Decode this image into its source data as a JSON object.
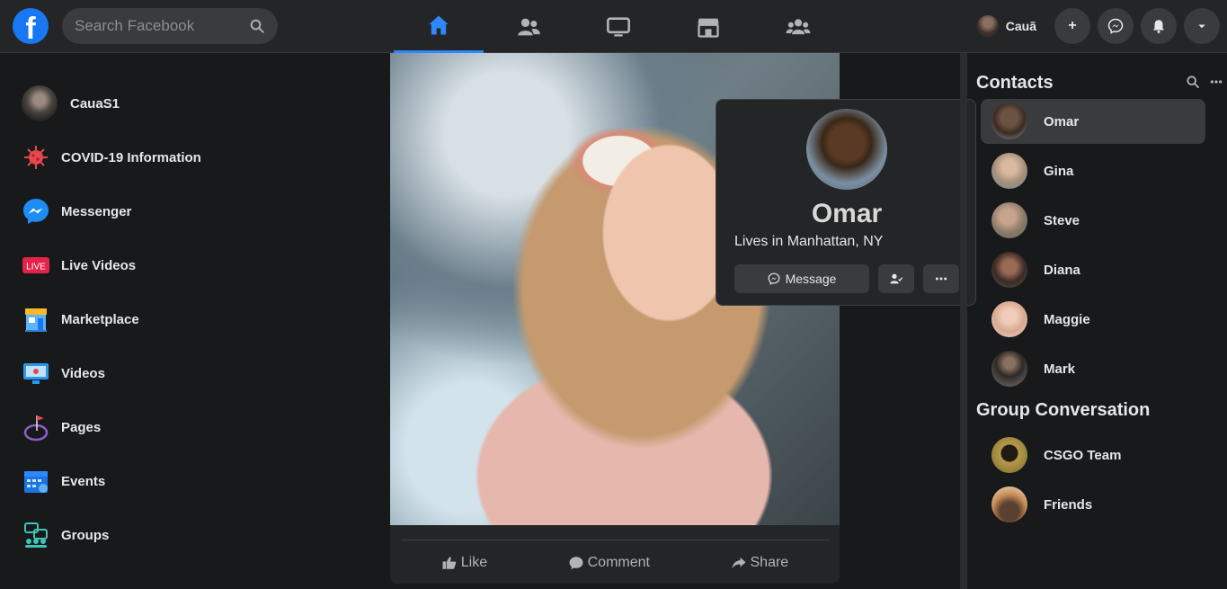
{
  "topbar": {
    "logo_letter": "f",
    "search_placeholder": "Search Facebook",
    "tabs": [
      {
        "name": "home",
        "active": true
      },
      {
        "name": "friends",
        "active": false
      },
      {
        "name": "watch",
        "active": false
      },
      {
        "name": "marketplace",
        "active": false
      },
      {
        "name": "groups",
        "active": false
      }
    ],
    "profile_name": "Cauã",
    "create_label": "+",
    "accent_color": "#2d88ff"
  },
  "left_nav": {
    "user_name": "CauaS1",
    "items": [
      {
        "label": "COVID-19 Information",
        "icon": "virus-icon"
      },
      {
        "label": "Messenger",
        "icon": "messenger-icon"
      },
      {
        "label": "Live Videos",
        "icon": "live-icon",
        "badge": "LIVE"
      },
      {
        "label": "Marketplace",
        "icon": "marketplace-icon"
      },
      {
        "label": "Videos",
        "icon": "videos-icon"
      },
      {
        "label": "Pages",
        "icon": "pages-icon"
      },
      {
        "label": "Events",
        "icon": "events-icon"
      },
      {
        "label": "Groups",
        "icon": "groups-icon"
      }
    ]
  },
  "post": {
    "actions": {
      "like": "Like",
      "comment": "Comment",
      "share": "Share"
    }
  },
  "hover_card": {
    "name": "Omar",
    "location": "Lives in Manhattan, NY",
    "message_label": "Message"
  },
  "contacts": {
    "title": "Contacts",
    "items": [
      {
        "name": "Omar",
        "color": "#6b5344"
      },
      {
        "name": "Gina",
        "color": "#a78f7a"
      },
      {
        "name": "Steve",
        "color": "#8a7a6a"
      },
      {
        "name": "Diana",
        "color": "#6a4d47"
      },
      {
        "name": "Maggie",
        "color": "#c9a08d"
      },
      {
        "name": "Mark",
        "color": "#5a5550"
      }
    ]
  },
  "groups": {
    "title": "Group Conversation",
    "items": [
      {
        "name": "CSGO Team",
        "color": "#b59a4a"
      },
      {
        "name": "Friends",
        "color": "#c78a55"
      }
    ]
  }
}
